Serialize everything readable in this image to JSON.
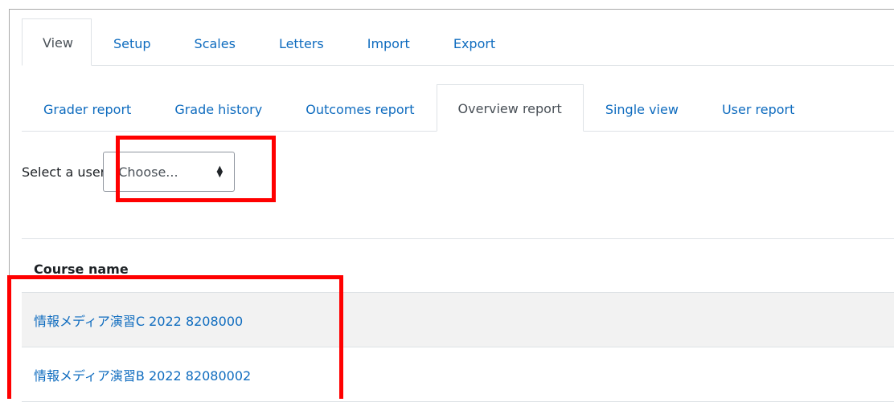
{
  "primary_tabs": [
    {
      "label": "View",
      "active": true
    },
    {
      "label": "Setup",
      "active": false
    },
    {
      "label": "Scales",
      "active": false
    },
    {
      "label": "Letters",
      "active": false
    },
    {
      "label": "Import",
      "active": false
    },
    {
      "label": "Export",
      "active": false
    }
  ],
  "secondary_tabs": [
    {
      "label": "Grader report",
      "active": false
    },
    {
      "label": "Grade history",
      "active": false
    },
    {
      "label": "Outcomes report",
      "active": false
    },
    {
      "label": "Overview report",
      "active": true
    },
    {
      "label": "Single view",
      "active": false
    },
    {
      "label": "User report",
      "active": false
    }
  ],
  "user_selector": {
    "label": "Select a user",
    "selected": "Choose..."
  },
  "table": {
    "header": "Course name",
    "rows": [
      {
        "course": "情報メディア演習C 2022 8208000"
      },
      {
        "course": "情報メディア演習B 2022 82080002"
      }
    ]
  },
  "colors": {
    "link": "#0f6cbf",
    "highlight": "#ff0000",
    "row_shade": "#f2f2f2"
  }
}
